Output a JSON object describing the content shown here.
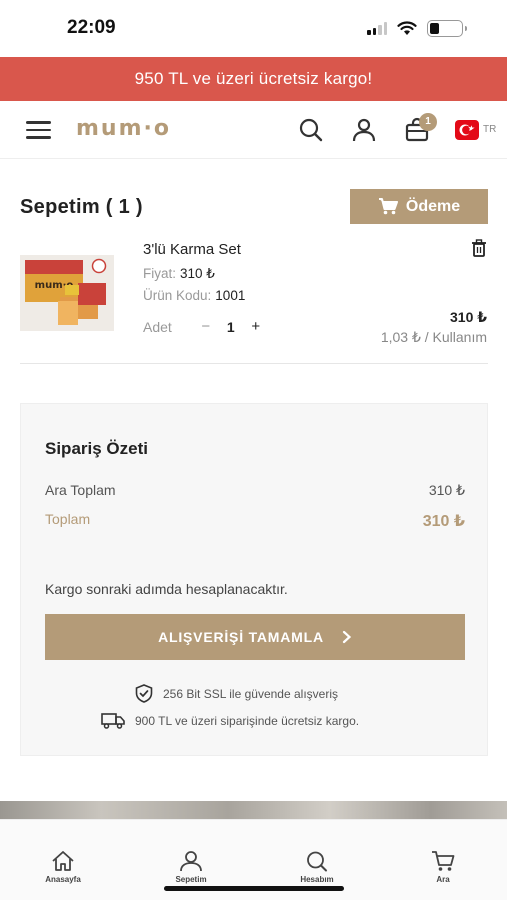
{
  "status_bar": {
    "time": "22:09"
  },
  "promo": {
    "text": "950 TL ve üzeri ücretsiz kargo!"
  },
  "header": {
    "logo": "mum·o",
    "cart_count": "1",
    "language": "TR",
    "icons": [
      "menu-icon",
      "search-icon",
      "user-icon",
      "shopping-bag-icon",
      "turkey-flag-icon"
    ]
  },
  "cart": {
    "title": "Sepetim ( 1 )",
    "checkout_label": "Ödeme",
    "item": {
      "name": "3'lü Karma Set",
      "price_label": "Fiyat:",
      "price": "310 ₺",
      "code_label": "Ürün Kodu:",
      "code": "1001",
      "qty_label": "Adet",
      "qty": "1",
      "line_total": "310 ₺",
      "per_use": "1,03 ₺ / Kullanım",
      "image_logo": "mum·o"
    }
  },
  "summary": {
    "title": "Sipariş Özeti",
    "subtotal_label": "Ara Toplam",
    "subtotal": "310 ₺",
    "total_label": "Toplam",
    "total": "310 ₺",
    "cargo_note": "Kargo sonraki adımda hesaplanacaktır.",
    "complete_label": "ALIŞVERİŞİ TAMAMLA",
    "ssl_text": "256 Bit SSL ile güvende alışveriş",
    "shipping_text": "900 TL ve üzeri siparişinde ücretsiz kargo."
  },
  "bottom_nav": [
    {
      "label": "Anasayfa",
      "icon": "home-icon"
    },
    {
      "label": "Sepetim",
      "icon": "user-icon"
    },
    {
      "label": "Hesabım",
      "icon": "search-icon"
    },
    {
      "label": "Ara",
      "icon": "cart-icon"
    }
  ],
  "colors": {
    "accent": "#b49b78",
    "promo": "#d9574c"
  }
}
